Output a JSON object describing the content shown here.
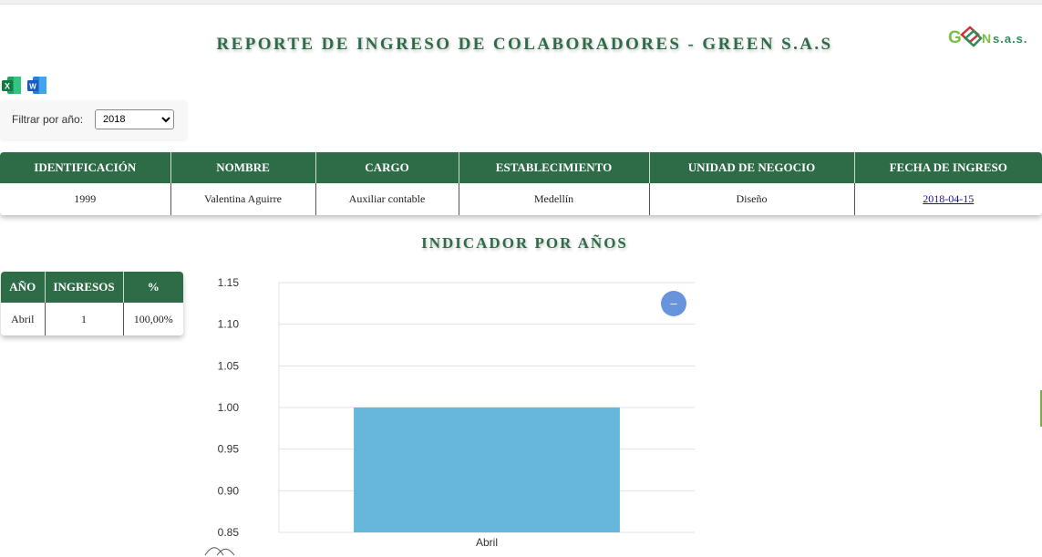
{
  "header": {
    "title": "REPORTE DE INGRESO DE COLABORADORES - GREEN S.A.S",
    "logo_text_main": "GREEN",
    "logo_text_suffix": "s.a.s."
  },
  "exports": {
    "excel_icon": "excel-icon",
    "excel_label": "X",
    "word_icon": "word-icon",
    "word_label": "W"
  },
  "filter": {
    "label": "Filtrar por año:",
    "selected": "2018"
  },
  "main_table": {
    "headers": [
      "IDENTIFICACIÓN",
      "NOMBRE",
      "CARGO",
      "ESTABLECIMIENTO",
      "UNIDAD DE NEGOCIO",
      "FECHA DE INGRESO"
    ],
    "rows": [
      [
        "1999",
        "Valentina Aguirre",
        "Auxiliar contable",
        "Medellín",
        "Diseño",
        "2018-04-15"
      ]
    ]
  },
  "indicator": {
    "title": "INDICADOR POR AÑOS",
    "table": {
      "headers": [
        "AÑO",
        "INGRESOS",
        "%"
      ],
      "rows": [
        [
          "Abril",
          "1",
          "100,00%"
        ]
      ]
    }
  },
  "chart_data": {
    "type": "bar",
    "categories": [
      "Abril"
    ],
    "values": [
      1
    ],
    "ylim": [
      0.85,
      1.15
    ],
    "yticks": [
      "1.15",
      "1.10",
      "1.05",
      "1.00",
      "0.95",
      "0.90",
      "0.85"
    ],
    "title": "",
    "xlabel": "",
    "ylabel": "",
    "grid": true,
    "bar_color": "#67b7dc",
    "zoom_out_button_label": "–",
    "zoom_button_color": "#6794dc"
  },
  "colors": {
    "brand_green": "#2e6b47",
    "logo_green": "#7bc043",
    "logo_red": "#d32f2f",
    "link": "#1a0dab"
  }
}
